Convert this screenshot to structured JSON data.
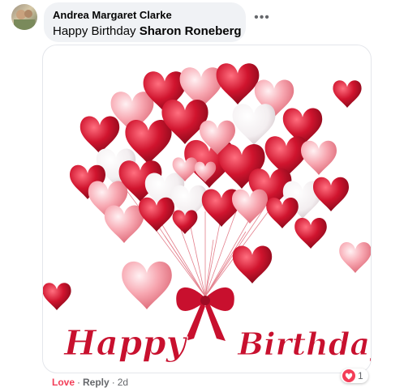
{
  "comment": {
    "author": "Andrea Margaret Clarke",
    "text_prefix": "Happy Birthday ",
    "mention": "Sharon Roneberg"
  },
  "image": {
    "greeting_line1": "Happy",
    "greeting_line2": "Birthday"
  },
  "actions": {
    "love_label": "Love",
    "separator": "·",
    "reply_label": "Reply",
    "timestamp": "2d"
  },
  "reactions": {
    "count": "1",
    "icon": "love-reaction-icon"
  },
  "colors": {
    "love": "#f33e58",
    "balloon_red": "#d0142e",
    "balloon_pink": "#f7a6b0",
    "ribbon": "#c8102e"
  }
}
